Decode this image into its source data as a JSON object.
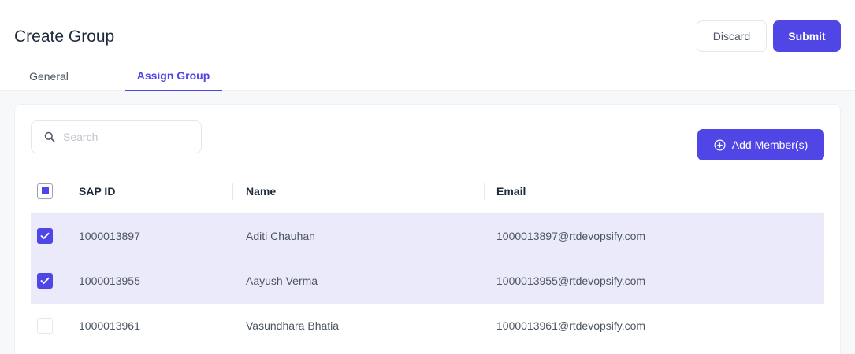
{
  "header": {
    "title": "Create Group",
    "discard_label": "Discard",
    "submit_label": "Submit"
  },
  "tabs": [
    {
      "label": "General",
      "active": false
    },
    {
      "label": "Assign Group",
      "active": true
    }
  ],
  "search": {
    "placeholder": "Search",
    "value": ""
  },
  "add_members_label": "Add Member(s)",
  "table": {
    "select_all_state": "indeterminate",
    "columns": [
      "SAP ID",
      "Name",
      "Email"
    ],
    "rows": [
      {
        "checked": true,
        "sap_id": "1000013897",
        "name": "Aditi Chauhan",
        "email": "1000013897@rtdevopsify.com"
      },
      {
        "checked": true,
        "sap_id": "1000013955",
        "name": "Aayush Verma",
        "email": "1000013955@rtdevopsify.com"
      },
      {
        "checked": false,
        "sap_id": "1000013961",
        "name": "Vasundhara Bhatia",
        "email": "1000013961@rtdevopsify.com"
      }
    ]
  },
  "colors": {
    "accent": "#4f46e5",
    "selected_row": "#ebeafa",
    "panel_bg": "#f7f8fa"
  },
  "icons": {
    "search": "search-icon",
    "add": "plus-circle-icon",
    "check": "check-icon"
  }
}
